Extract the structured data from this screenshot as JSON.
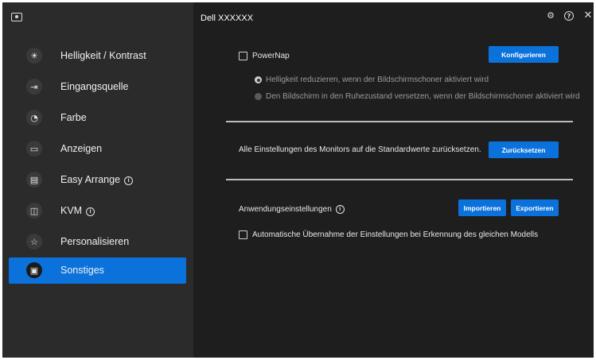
{
  "sidebar": {
    "items": [
      {
        "label": "Helligkeit / Kontrast",
        "icon": "sun-icon",
        "glyph": "☀",
        "info": false,
        "active": false
      },
      {
        "label": "Eingangsquelle",
        "icon": "input-source-icon",
        "glyph": "⇥",
        "info": false,
        "active": false
      },
      {
        "label": "Farbe",
        "icon": "palette-icon",
        "glyph": "◔",
        "info": false,
        "active": false
      },
      {
        "label": "Anzeigen",
        "icon": "monitor-icon",
        "glyph": "▭",
        "info": false,
        "active": false
      },
      {
        "label": "Easy Arrange",
        "icon": "layout-icon",
        "glyph": "▤",
        "info": true,
        "active": false
      },
      {
        "label": "KVM",
        "icon": "kvm-icon",
        "glyph": "◫",
        "info": true,
        "active": false
      },
      {
        "label": "Personalisieren",
        "icon": "star-icon",
        "glyph": "☆",
        "info": false,
        "active": false
      },
      {
        "label": "Sonstiges",
        "icon": "others-icon",
        "glyph": "▣",
        "info": false,
        "active": true
      }
    ],
    "info_glyph": "i"
  },
  "header": {
    "title": "Dell XXXXXX",
    "settings_glyph": "⚙",
    "help_glyph": "?",
    "close_glyph": "✕"
  },
  "powernap": {
    "label": "PowerNap",
    "checked": false,
    "configure_label": "Konfigurieren",
    "option1": "Helligkeit reduzieren, wenn der Bildschirmschoner aktiviert wird",
    "option2": "Den Bildschirm in den Ruhezustand versetzen, wenn der Bildschirmschoner aktiviert wird"
  },
  "reset": {
    "text": "Alle Einstellungen des Monitors auf die Standardwerte zurücksetzen.",
    "button_label": "Zurücksetzen"
  },
  "app_settings": {
    "label": "Anwendungseinstellungen",
    "import_label": "Importieren",
    "export_label": "Exportieren",
    "auto_label": "Automatische Übernahme der Einstellungen bei Erkennung des gleichen Modells",
    "auto_checked": false
  },
  "colors": {
    "accent": "#0b72dc",
    "sidebar_bg": "#2b2b2b",
    "main_bg": "#1e1e1e"
  }
}
